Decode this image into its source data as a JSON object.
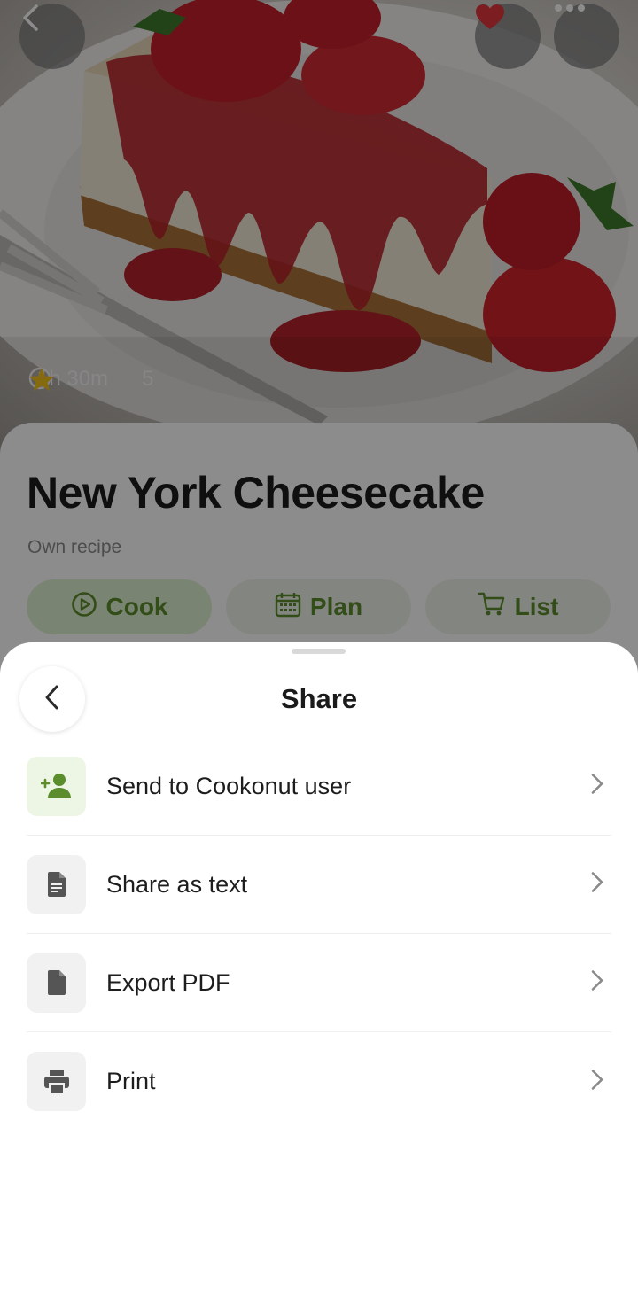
{
  "hero": {
    "time": "1h 30m",
    "rating": "5"
  },
  "recipe": {
    "title": "New York Cheesecake",
    "subtitle": "Own recipe",
    "actions": [
      {
        "label": "Cook",
        "icon": "play-circle-icon"
      },
      {
        "label": "Plan",
        "icon": "calendar-icon"
      },
      {
        "label": "List",
        "icon": "cart-icon"
      }
    ]
  },
  "sheet": {
    "title": "Share",
    "items": [
      {
        "label": "Send to Cookonut user",
        "icon": "add-user-icon"
      },
      {
        "label": "Share as text",
        "icon": "text-document-icon"
      },
      {
        "label": "Export PDF",
        "icon": "document-icon"
      },
      {
        "label": "Print",
        "icon": "printer-icon"
      }
    ]
  },
  "colors": {
    "accent_green": "#5c8d2c",
    "heart_red": "#e0363c",
    "star_gold": "#f2c21b"
  }
}
